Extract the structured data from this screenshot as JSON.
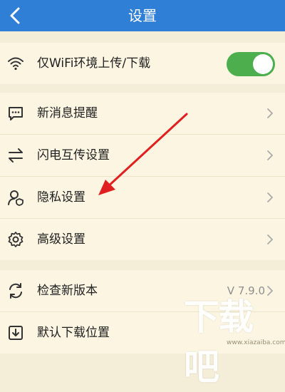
{
  "header": {
    "title": "设置"
  },
  "wifi_row": {
    "label": "仅WiFi环境上传/下载",
    "toggle_on": true
  },
  "items": [
    {
      "label": "新消息提醒"
    },
    {
      "label": "闪电互传设置"
    },
    {
      "label": "隐私设置"
    },
    {
      "label": "高级设置"
    }
  ],
  "version_row": {
    "label": "检查新版本",
    "value": "V 7.9.0"
  },
  "download_row": {
    "label": "默认下载位置"
  },
  "watermark": {
    "logo_text": "下载吧",
    "url": "www.xiazaiba.com"
  },
  "colors": {
    "header": "#2f7fd6",
    "toggle": "#4cae4c",
    "arrow": "#e02020",
    "background": "#f4edd7"
  }
}
